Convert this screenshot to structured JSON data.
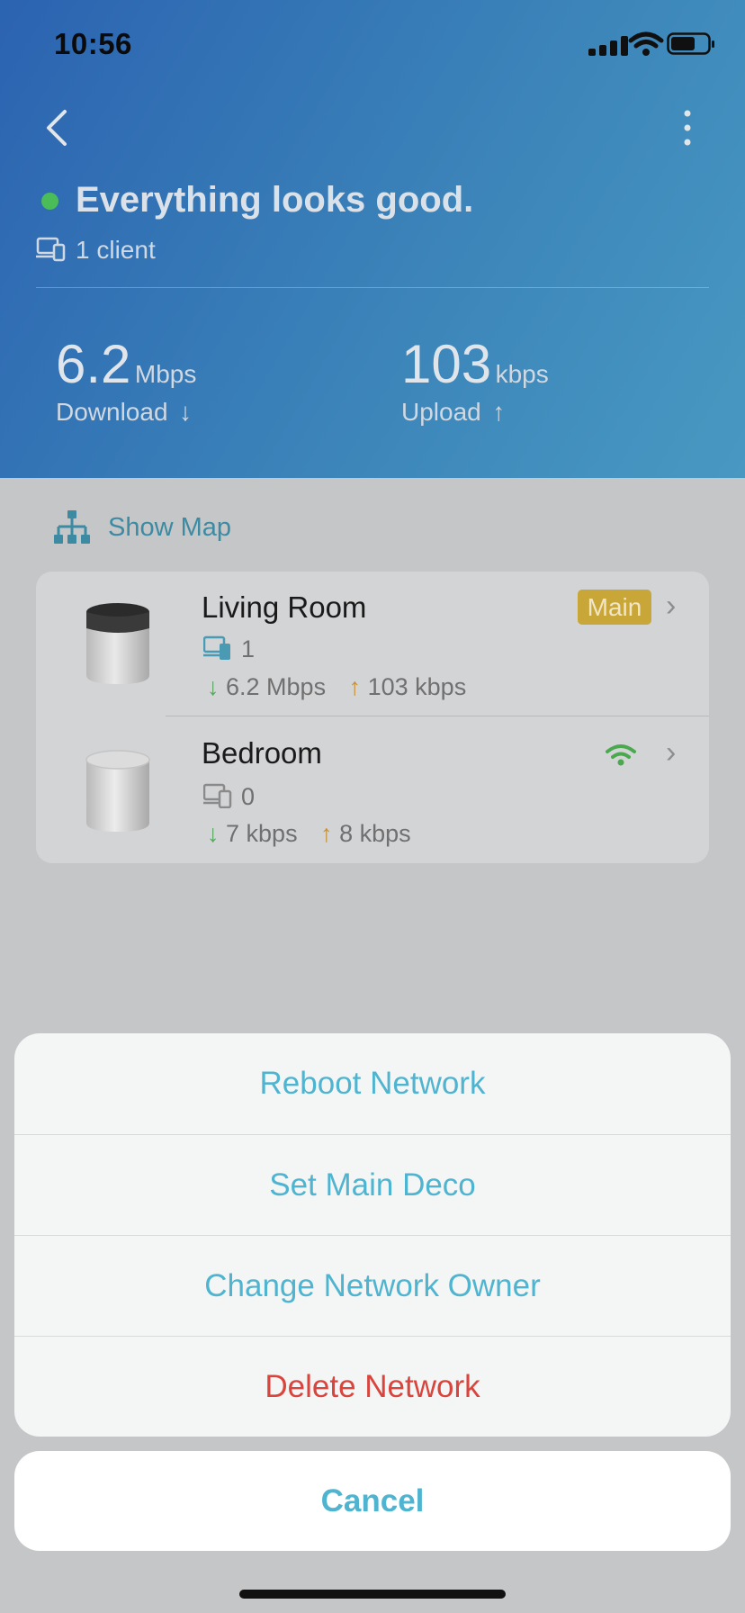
{
  "status_bar": {
    "time": "10:56"
  },
  "header": {
    "status_title": "Everything looks good.",
    "client_count": "1 client",
    "download": {
      "value": "6.2",
      "unit": "Mbps",
      "label": "Download",
      "arrow": "↓"
    },
    "upload": {
      "value": "103",
      "unit": "kbps",
      "label": "Upload",
      "arrow": "↑"
    }
  },
  "show_map": {
    "label": "Show Map"
  },
  "decos": [
    {
      "name": "Living Room",
      "clients": "1",
      "down": "6.2 Mbps",
      "up": "103 kbps",
      "badge": "Main"
    },
    {
      "name": "Bedroom",
      "clients": "0",
      "down": "7 kbps",
      "up": "8 kbps"
    }
  ],
  "action_sheet": {
    "items": [
      "Reboot Network",
      "Set Main Deco",
      "Change Network Owner",
      "Delete Network"
    ],
    "cancel": "Cancel"
  },
  "colors": {
    "accent": "#4fb4d0",
    "danger": "#d9443d",
    "status_ok": "#4cc05a",
    "main_badge": "#c8a637",
    "header_gradient_start": "#2c66b5",
    "header_gradient_end": "#4a9cc6"
  },
  "icons": {
    "back": "chevron-left-icon",
    "more": "more-vertical-icon",
    "client": "client-device-icon",
    "map": "network-map-icon",
    "wifi": "wifi-signal-icon",
    "chevron": "chevron-right-icon"
  }
}
